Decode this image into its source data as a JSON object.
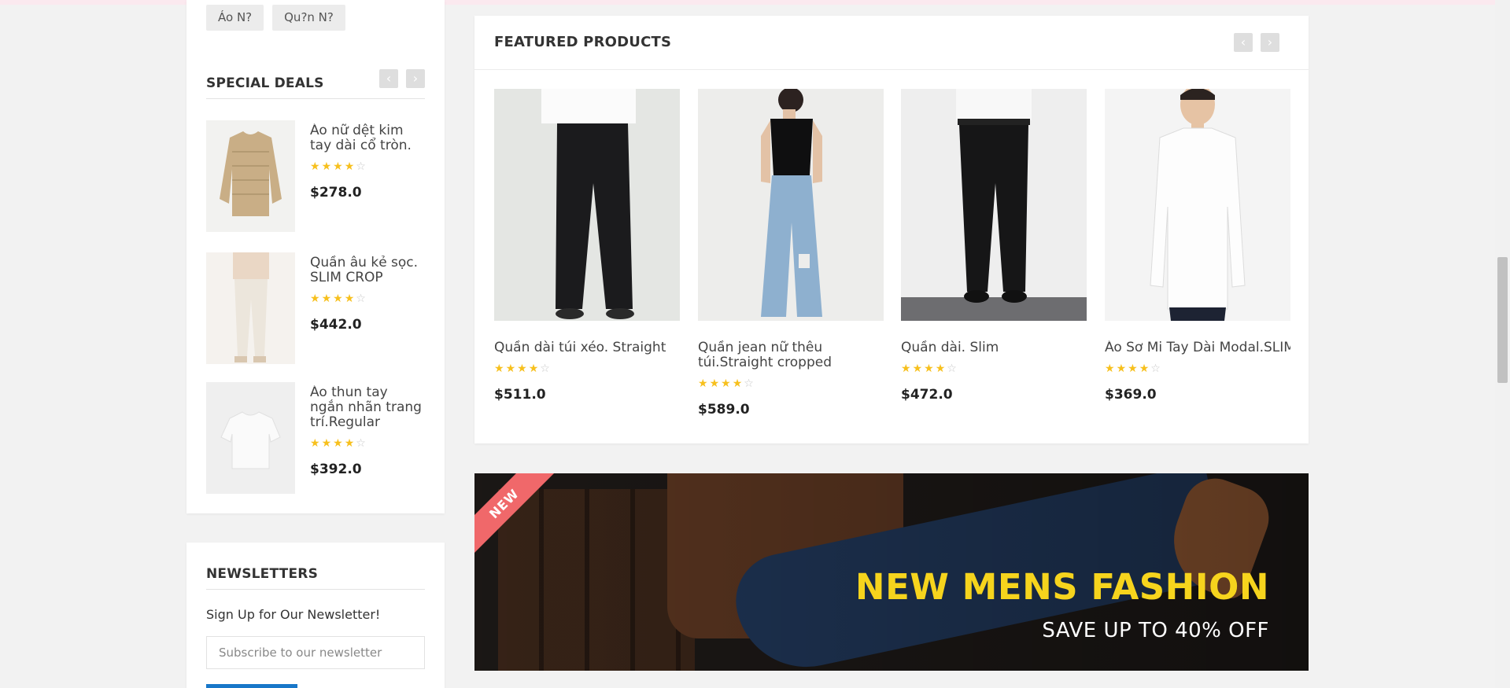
{
  "sidebar": {
    "tags": [
      "Áo N?",
      "Qu?n N?"
    ],
    "special_deals": {
      "title": "SPECIAL DEALS",
      "items": [
        {
          "name": "Áo nữ dệt kim tay dài cổ tròn. Regular",
          "rating": 4,
          "price": "$278.0"
        },
        {
          "name": "Quần âu kẻ sọc. SLIM CROP",
          "rating": 4,
          "price": "$442.0"
        },
        {
          "name": "Áo thun tay ngắn nhãn trang trí.Regular",
          "rating": 4,
          "price": "$392.0"
        }
      ]
    },
    "newsletter": {
      "title": "NEWSLETTERS",
      "subtitle": "Sign Up for Our Newsletter!",
      "placeholder": "Subscribe to our newsletter"
    }
  },
  "featured": {
    "title": "FEATURED PRODUCTS",
    "products": [
      {
        "name": "Quần dài túi xéo. Straight",
        "rating": 4,
        "price": "$511.0"
      },
      {
        "name": "Quần jean nữ thêu túi.Straight cropped",
        "rating": 4,
        "price": "$589.0"
      },
      {
        "name": "Quần dài. Slim",
        "rating": 4,
        "price": "$472.0"
      },
      {
        "name": "Áo Sơ Mi Tay Dài Modal.SLIM",
        "rating": 4,
        "price": "$369.0"
      }
    ]
  },
  "banner": {
    "ribbon": "NEW",
    "title": "NEW MENS FASHION",
    "subtitle": "SAVE UP TO 40% OFF"
  },
  "colors": {
    "star": "#f7c01d",
    "banner_title": "#f6d41d",
    "ribbon": "#f0686a",
    "button": "#1877c9"
  },
  "icons": {
    "prev": "chevron-left-icon",
    "next": "chevron-right-icon",
    "star": "star-icon"
  }
}
